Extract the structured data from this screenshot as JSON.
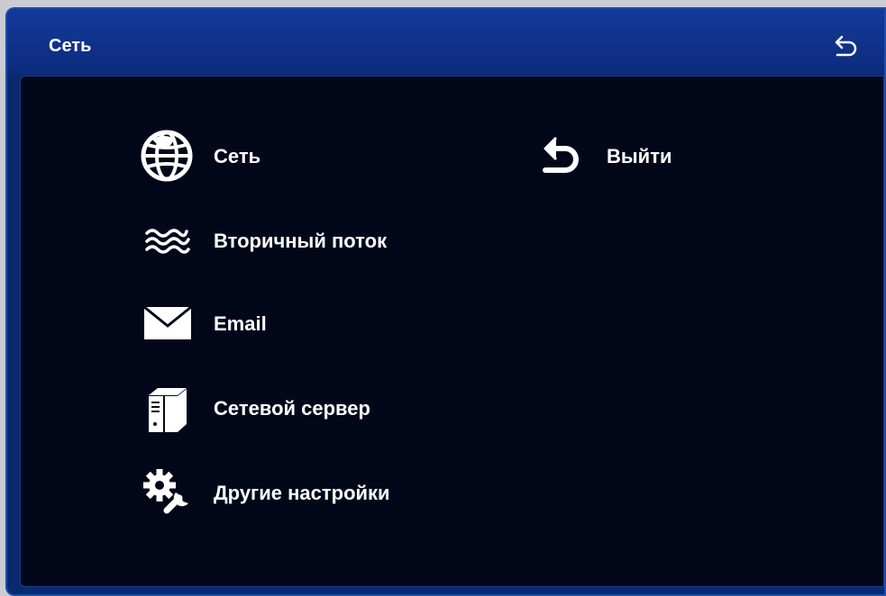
{
  "window": {
    "title": "Сеть",
    "back_icon": "back-arrow-icon"
  },
  "menu": {
    "items": [
      {
        "label": "Сеть",
        "icon": "globe-icon"
      },
      {
        "label": "Вторичный поток",
        "icon": "waves-icon"
      },
      {
        "label": "Email",
        "icon": "envelope-icon"
      },
      {
        "label": "Сетевой сервер",
        "icon": "server-icon"
      },
      {
        "label": "Другие настройки",
        "icon": "gear-wrench-icon"
      }
    ],
    "exit": {
      "label": "Выйти",
      "icon": "back-arrow-icon"
    }
  },
  "colors": {
    "titlebar": "#0c2c7c",
    "content_bg": "#03071a",
    "text": "#ffffff"
  }
}
